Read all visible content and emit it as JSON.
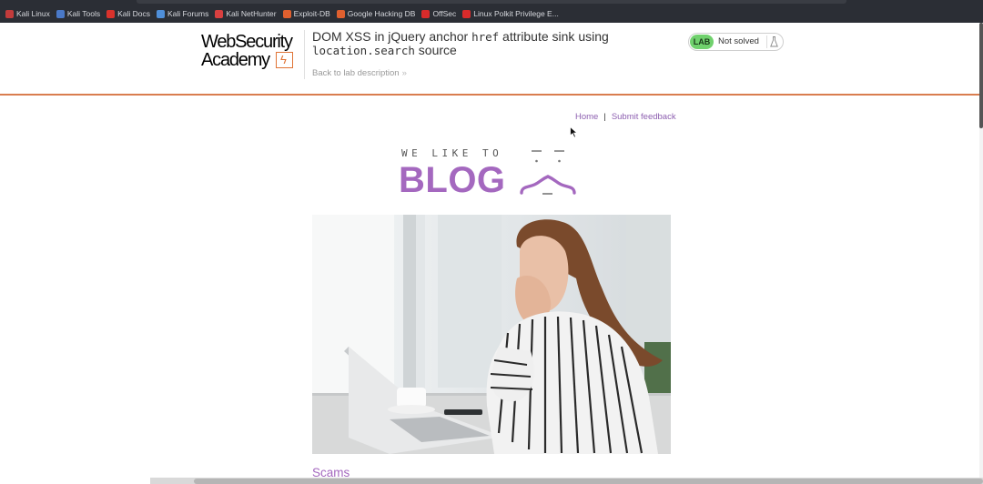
{
  "browser": {
    "bookmarks": [
      {
        "label": "Kali Linux",
        "icon": "kali-dragon-icon",
        "color": "#c23b3b"
      },
      {
        "label": "Kali Tools",
        "icon": "kali-tools-icon",
        "color": "#4a79c8"
      },
      {
        "label": "Kali Docs",
        "icon": "kali-docs-icon",
        "color": "#d9322c"
      },
      {
        "label": "Kali Forums",
        "icon": "kali-forums-icon",
        "color": "#4f8fd9"
      },
      {
        "label": "Kali NetHunter",
        "icon": "nethunter-icon",
        "color": "#d94040"
      },
      {
        "label": "Exploit-DB",
        "icon": "exploit-db-icon",
        "color": "#e0602f"
      },
      {
        "label": "Google Hacking DB",
        "icon": "ghdb-icon",
        "color": "#e0602f"
      },
      {
        "label": "OffSec",
        "icon": "offsec-icon",
        "color": "#d92b2b"
      },
      {
        "label": "Linux Polkit Privilege E...",
        "icon": "polkit-icon",
        "color": "#d92b2b"
      }
    ]
  },
  "lab": {
    "logo_line1": "WebSecurity",
    "logo_line2": "Academy",
    "title_part1": "DOM XSS in jQuery anchor ",
    "title_code1": "href",
    "title_part2": " attribute sink using",
    "title_code2": "location.search",
    "title_part3": " source",
    "back_link": "Back to lab description",
    "back_chevron": "»",
    "badge": "LAB",
    "status": "Not solved",
    "status_icon": "flask-icon",
    "colors": {
      "accent": "#e07335",
      "badge": "#70d16d"
    }
  },
  "nav": {
    "home": "Home",
    "separator": "|",
    "feedback": "Submit feedback"
  },
  "blog": {
    "tagline": "WE LIKE TO",
    "wordmark": "BLOG",
    "brand_color": "#a468bf"
  },
  "post": {
    "image_alt": "Woman covering her mouth looking at a laptop",
    "title": "Scams"
  }
}
